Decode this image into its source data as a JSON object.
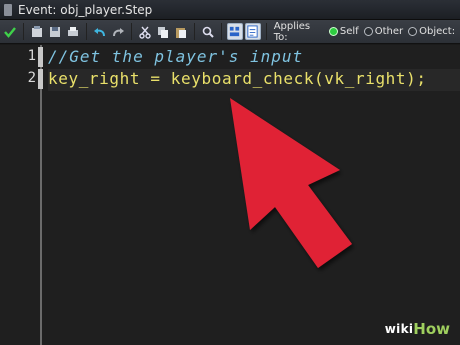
{
  "window": {
    "title": "Event: obj_player.Step"
  },
  "toolbar": {
    "applies_to_label": "Applies To:",
    "options": [
      {
        "label": "Self",
        "selected": true
      },
      {
        "label": "Other",
        "selected": false
      },
      {
        "label": "Object:",
        "selected": false
      }
    ]
  },
  "editor": {
    "lines": [
      {
        "number": "1",
        "text": "//Get the player's input"
      },
      {
        "number": "2",
        "text": "key_right = keyboard_check(vk_right);"
      }
    ]
  },
  "watermark": {
    "wiki": "wiki",
    "how": "How"
  },
  "colors": {
    "comment": "#7fc3e0",
    "code": "#e9e06a",
    "arrow": "#e02436",
    "brand_green": "#9fcf5e"
  }
}
